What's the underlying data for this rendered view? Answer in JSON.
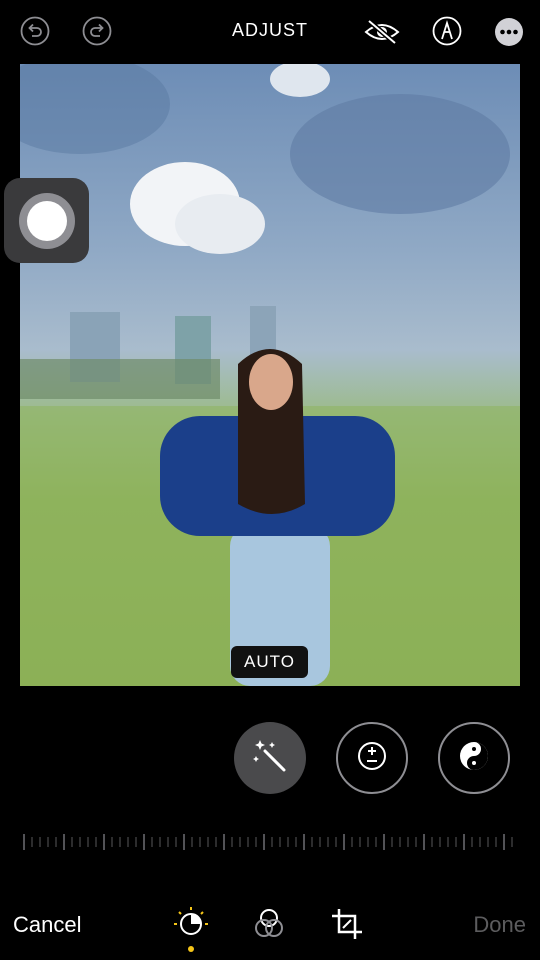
{
  "header": {
    "title": "ADJUST",
    "undo_icon": "undo-icon",
    "redo_icon": "redo-icon",
    "hide_icon": "eye-slash-icon",
    "markup_icon": "markup-pen-icon",
    "more_icon": "more-ellipsis-icon"
  },
  "photo": {
    "badge_label": "AUTO"
  },
  "tools": [
    {
      "name": "auto-enhance",
      "icon": "magic-wand-icon",
      "active": true
    },
    {
      "name": "exposure",
      "icon": "plus-minus-icon",
      "active": false
    },
    {
      "name": "brilliance",
      "icon": "yin-yang-icon",
      "active": false
    }
  ],
  "footer": {
    "cancel_label": "Cancel",
    "done_label": "Done",
    "tabs": [
      "adjust-dial-icon",
      "filters-icon",
      "crop-icon"
    ]
  },
  "colors": {
    "background": "#000000",
    "active_tool": "#4a4a4c",
    "selected_dot": "#f5c518",
    "disabled_text": "#5c5c5e"
  }
}
